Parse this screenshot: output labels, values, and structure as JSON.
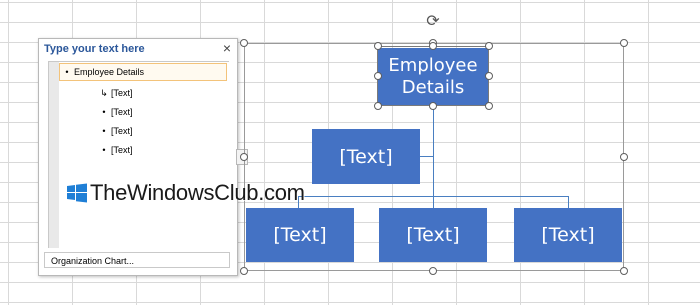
{
  "text_pane": {
    "title": "Type your text here",
    "close_glyph": "×",
    "items": [
      {
        "level": 0,
        "bullet": "•",
        "text": "Employee Details"
      },
      {
        "level": 1,
        "bullet": "↳",
        "text": "[Text]"
      },
      {
        "level": 1,
        "bullet": "•",
        "text": "[Text]"
      },
      {
        "level": 1,
        "bullet": "•",
        "text": "[Text]"
      },
      {
        "level": 1,
        "bullet": "•",
        "text": "[Text]"
      }
    ],
    "footer": "Organization Chart...",
    "toggle_glyph": "›"
  },
  "org_chart": {
    "top": "Employee Details",
    "assistant": "[Text]",
    "subordinates": [
      "[Text]",
      "[Text]",
      "[Text]"
    ],
    "rotate_glyph": "⟳"
  },
  "watermark": {
    "text": "TheWindowsClub.com",
    "icon": "windows-logo-icon"
  },
  "colors": {
    "shape_fill": "#4472c4",
    "connector": "#4a7fc1",
    "pane_title": "#2b579a",
    "active_row_border": "#f3c37a"
  }
}
